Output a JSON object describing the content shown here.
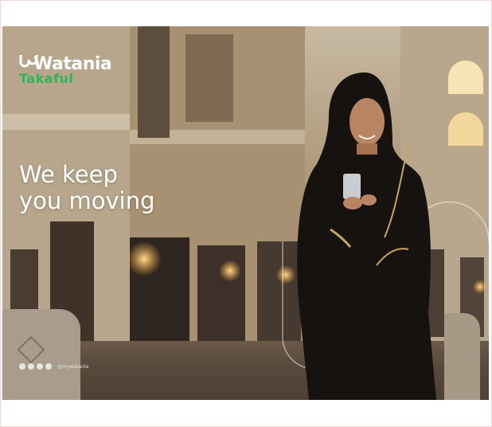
{
  "brand": {
    "name": "Watania",
    "sub": "Takaful",
    "sub_color": "#35b25a"
  },
  "headline": {
    "line1": "We keep",
    "line2": "you moving"
  },
  "social": {
    "icons": [
      "instagram-icon",
      "twitter-icon",
      "facebook-icon",
      "youtube-icon"
    ],
    "handle": "@mywatania"
  }
}
